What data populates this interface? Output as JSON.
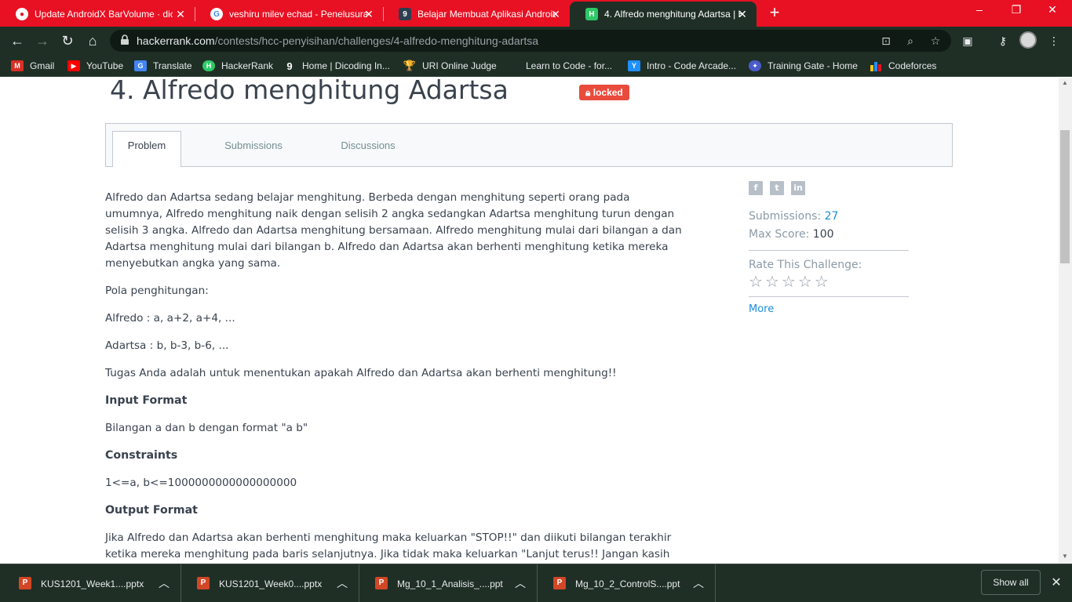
{
  "browser": {
    "tabs": [
      {
        "title": "Update AndroidX BarVolume · dic",
        "favicon": "github-icon",
        "color": "#ffffff"
      },
      {
        "title": "veshiru milev echad - Penelusuran",
        "favicon": "google-icon",
        "color": "#ffffff"
      },
      {
        "title": "Belajar Membuat Aplikasi Android",
        "favicon": "dicoding-icon",
        "color": "#ffffff"
      },
      {
        "title": "4. Alfredo menghitung Adartsa | H",
        "favicon": "hackerrank-icon",
        "color": "#ffffff"
      }
    ],
    "new_tab": "+",
    "window_controls": {
      "minimize": "–",
      "maximize": "❐",
      "close": "✕"
    },
    "url_host": "hackerrank.com",
    "url_path": "/contests/hcc-penyisihan/challenges/4-alfredo-menghitung-adartsa",
    "bookmarks": [
      {
        "label": "Gmail",
        "icon": "gmail-icon",
        "color": "#d93025"
      },
      {
        "label": "YouTube",
        "icon": "youtube-icon",
        "color": "#ff0000"
      },
      {
        "label": "Translate",
        "icon": "translate-icon",
        "color": "#4285f4"
      },
      {
        "label": "HackerRank",
        "icon": "hackerrank-icon",
        "color": "#2ec866"
      },
      {
        "label": "Home | Dicoding In...",
        "icon": "dicoding-icon",
        "color": "#2d3e50"
      },
      {
        "label": "URI Online Judge",
        "icon": "trophy-icon",
        "color": "#e5a823"
      },
      {
        "label": "Learn to Code - for...",
        "icon": "freecodecamp-icon",
        "color": "#1f2f26"
      },
      {
        "label": "Intro - Code Arcade...",
        "icon": "codesignal-icon",
        "color": "#1e90ff"
      },
      {
        "label": "Training Gate - Home",
        "icon": "training-gate-icon",
        "color": "#4a5cc8"
      },
      {
        "label": "Codeforces",
        "icon": "codeforces-icon",
        "color": "#f5c518"
      }
    ]
  },
  "challenge": {
    "title": "4. Alfredo menghitung Adartsa",
    "badge": "locked",
    "tabs": [
      "Problem",
      "Submissions",
      "Discussions"
    ],
    "active_tab": "Problem",
    "body": {
      "p1": "Alfredo dan Adartsa sedang belajar menghitung. Berbeda dengan menghitung seperti orang pada umumnya, Alfredo menghitung naik dengan selisih 2 angka sedangkan Adartsa menghitung turun dengan selisih 3 angka. Alfredo dan Adartsa menghitung bersamaan. Alfredo menghitung mulai dari bilangan a dan Adartsa menghitung mulai dari bilangan b. Alfredo dan Adartsa akan berhenti menghitung ketika mereka menyebutkan angka yang sama.",
      "p2": "Pola penghitungan:",
      "p3": "Alfredo : a, a+2, a+4, ...",
      "p4": "Adartsa : b, b-3, b-6, ...",
      "p5": "Tugas Anda adalah untuk menentukan apakah Alfredo dan Adartsa akan berhenti menghitung!!",
      "h_input": "Input Format",
      "p_input": "Bilangan a dan b dengan format \"a b\"",
      "h_constraints": "Constraints",
      "p_constraints": "1<=a, b<=1000000000000000000",
      "h_output": "Output Format",
      "p_output": "Jika Alfredo dan Adartsa akan berhenti menghitung maka keluarkan \"STOP!!\" dan diikuti bilangan terakhir ketika mereka menghitung pada baris selanjutnya. Jika tidak maka keluarkan \"Lanjut terus!! Jangan kasih"
    },
    "sidebar": {
      "share": [
        "f",
        "t",
        "in"
      ],
      "submissions_label": "Submissions:",
      "submissions_value": "27",
      "max_score_label": "Max Score:",
      "max_score_value": "100",
      "rate_label": "Rate This Challenge:",
      "stars": [
        "☆",
        "☆",
        "☆",
        "☆",
        "☆"
      ],
      "more": "More"
    }
  },
  "downloads": {
    "items": [
      {
        "name": "KUS1201_Week1....pptx"
      },
      {
        "name": "KUS1201_Week0....pptx"
      },
      {
        "name": "Mg_10_1_Analisis_....ppt"
      },
      {
        "name": "Mg_10_2_ControlS....ppt"
      }
    ],
    "show_all": "Show all",
    "close": "✕"
  },
  "colors": {
    "tabstrip": "#e81123",
    "chrome_dark": "#1f2f26",
    "badge": "#e94b3c",
    "link": "#1b8fd8",
    "text": "#39424e"
  }
}
